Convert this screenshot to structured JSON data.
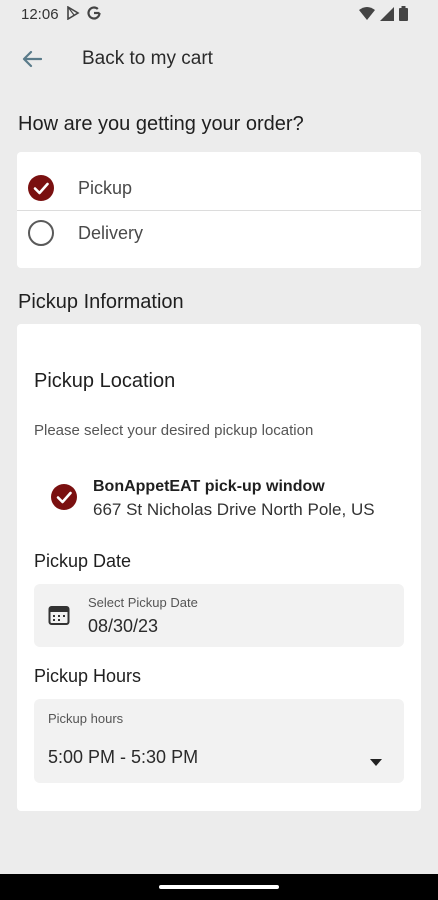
{
  "status_bar": {
    "time": "12:06",
    "left_icons": [
      "play-store-icon",
      "google-icon"
    ],
    "right_icons": [
      "wifi-icon",
      "signal-icon",
      "battery-icon"
    ]
  },
  "app_bar": {
    "back_label": "Back to my cart"
  },
  "order_method": {
    "title": "How are you getting your order?",
    "options": [
      {
        "label": "Pickup",
        "selected": true
      },
      {
        "label": "Delivery",
        "selected": false
      }
    ]
  },
  "pickup_info": {
    "section_title": "Pickup Information",
    "location_title": "Pickup Location",
    "location_desc": "Please select your desired pickup location",
    "location": {
      "name": "BonAppetEAT pick-up window",
      "address": "667 St Nicholas Drive North Pole, US",
      "selected": true
    },
    "date_title": "Pickup Date",
    "date_field": {
      "label": "Select Pickup Date",
      "value": "08/30/23"
    },
    "hours_title": "Pickup Hours",
    "hours_field": {
      "label": "Pickup hours",
      "value": "5:00 PM - 5:30 PM"
    }
  },
  "colors": {
    "accent": "#7a1010",
    "background": "#ececec",
    "card": "#ffffff",
    "field": "#f2f2f2"
  }
}
